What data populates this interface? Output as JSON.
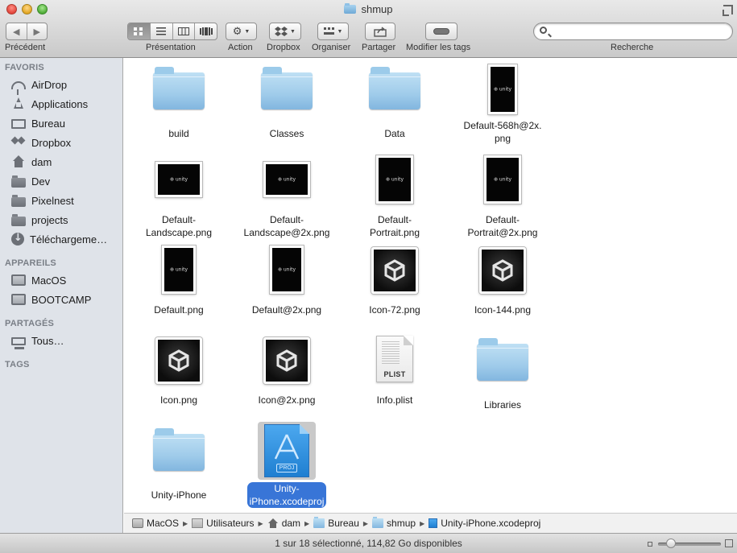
{
  "window": {
    "title": "shmup"
  },
  "toolbar": {
    "back_forward_label": "Précédent",
    "view_label": "Présentation",
    "action_label": "Action",
    "dropbox_label": "Dropbox",
    "arrange_label": "Organiser",
    "share_label": "Partager",
    "tags_label": "Modifier les tags",
    "search_label": "Recherche",
    "search_placeholder": "",
    "active_view": "icons"
  },
  "sidebar": {
    "favorites_header": "FAVORIS",
    "favorites": [
      {
        "label": "AirDrop",
        "icon": "airdrop-icon"
      },
      {
        "label": "Applications",
        "icon": "applications-icon"
      },
      {
        "label": "Bureau",
        "icon": "desktop-icon"
      },
      {
        "label": "Dropbox",
        "icon": "dropbox-icon"
      },
      {
        "label": "dam",
        "icon": "home-icon"
      },
      {
        "label": "Dev",
        "icon": "folder-icon"
      },
      {
        "label": "Pixelnest",
        "icon": "folder-icon"
      },
      {
        "label": "projects",
        "icon": "folder-icon"
      },
      {
        "label": "Téléchargeme…",
        "icon": "downloads-icon"
      }
    ],
    "devices_header": "APPAREILS",
    "devices": [
      {
        "label": "MacOS",
        "icon": "hard-disk-icon"
      },
      {
        "label": "BOOTCAMP",
        "icon": "hard-disk-icon"
      }
    ],
    "shared_header": "PARTAGÉS",
    "shared": [
      {
        "label": "Tous…",
        "icon": "network-icon"
      }
    ],
    "tags_header": "TAGS"
  },
  "files": [
    {
      "name": "build",
      "kind": "folder"
    },
    {
      "name": "Classes",
      "kind": "folder"
    },
    {
      "name": "Data",
      "kind": "folder"
    },
    {
      "name": "Default-568h@2x.\npng",
      "kind": "portrait-image"
    },
    {
      "name": "Default-\nLandscape.png",
      "kind": "landscape-image"
    },
    {
      "name": "Default-\nLandscape@2x.png",
      "kind": "landscape-image"
    },
    {
      "name": "Default-\nPortrait.png",
      "kind": "portrait-image"
    },
    {
      "name": "Default-\nPortrait@2x.png",
      "kind": "portrait-image"
    },
    {
      "name": "Default.png",
      "kind": "portrait-image"
    },
    {
      "name": "Default@2x.png",
      "kind": "portrait-image"
    },
    {
      "name": "Icon-72.png",
      "kind": "app-icon"
    },
    {
      "name": "Icon-144.png",
      "kind": "app-icon"
    },
    {
      "name": "Icon.png",
      "kind": "app-icon"
    },
    {
      "name": "Icon@2x.png",
      "kind": "app-icon"
    },
    {
      "name": "Info.plist",
      "kind": "plist"
    },
    {
      "name": "Libraries",
      "kind": "folder"
    },
    {
      "name": "Unity-iPhone",
      "kind": "folder"
    },
    {
      "name": "Unity-\niPhone.xcodeproj",
      "kind": "xcodeproj",
      "selected": true
    }
  ],
  "thumb_text": {
    "unity_mark": "⊕ unity",
    "plist_tag": "PLIST",
    "xcodeproj_tag": "PROJ"
  },
  "pathbar": [
    {
      "label": "MacOS",
      "icon": "disk"
    },
    {
      "label": "Utilisateurs",
      "icon": "users"
    },
    {
      "label": "dam",
      "icon": "home"
    },
    {
      "label": "Bureau",
      "icon": "folder"
    },
    {
      "label": "shmup",
      "icon": "folder"
    },
    {
      "label": "Unity-iPhone.xcodeproj",
      "icon": "proj"
    }
  ],
  "status": {
    "text": "1 sur 18 sélectionné, 114,82 Go disponibles",
    "icon_size_fraction": 0.2
  }
}
